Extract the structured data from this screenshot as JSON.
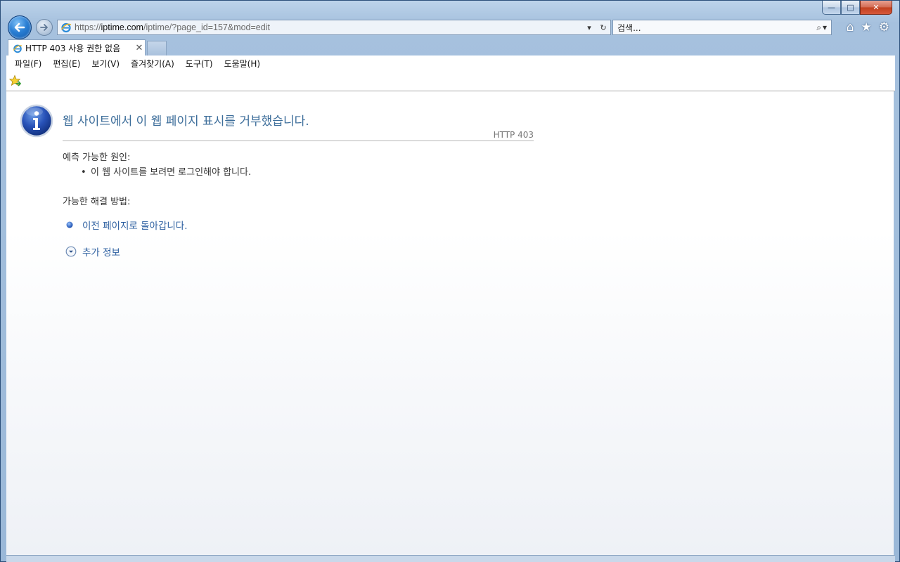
{
  "window": {
    "controls": {
      "minimize": "—",
      "maximize": "□",
      "close": "✕"
    }
  },
  "nav": {
    "back_icon": "back-arrow-icon",
    "forward_icon": "forward-arrow-icon",
    "address_prefix": "https://",
    "address_host": "iptime.com",
    "address_path": "/iptime/?page_id=157&mod=edit",
    "address_dropdown": "▾",
    "refresh": "↻",
    "search_placeholder": "검색...",
    "search_icon": "⌕",
    "search_dropdown": "▾",
    "home": "⌂",
    "favorites": "★",
    "tools": "⚙"
  },
  "tab": {
    "title": "HTTP 403 사용 권한 없음",
    "close": "✕"
  },
  "menu": {
    "items": [
      "파일(F)",
      "편집(E)",
      "보기(V)",
      "즐겨찾기(A)",
      "도구(T)",
      "도움말(H)"
    ]
  },
  "content": {
    "heading": "웹 사이트에서 이 웹 페이지 표시를 거부했습니다.",
    "http_code": "HTTP 403",
    "causes_label": "예측 가능한 원인:",
    "cause_bullet": "•",
    "cause_1": "이 웹 사이트를 보려면 로그인해야 합니다.",
    "solutions_label": "가능한 해결 방법:",
    "go_back_link": "이전 페이지로 돌아갑니다.",
    "more_info_link": "추가 정보"
  },
  "colors": {
    "heading": "#3c6d9a",
    "link": "#2a5d9f",
    "accent": "#1f5fb0"
  }
}
